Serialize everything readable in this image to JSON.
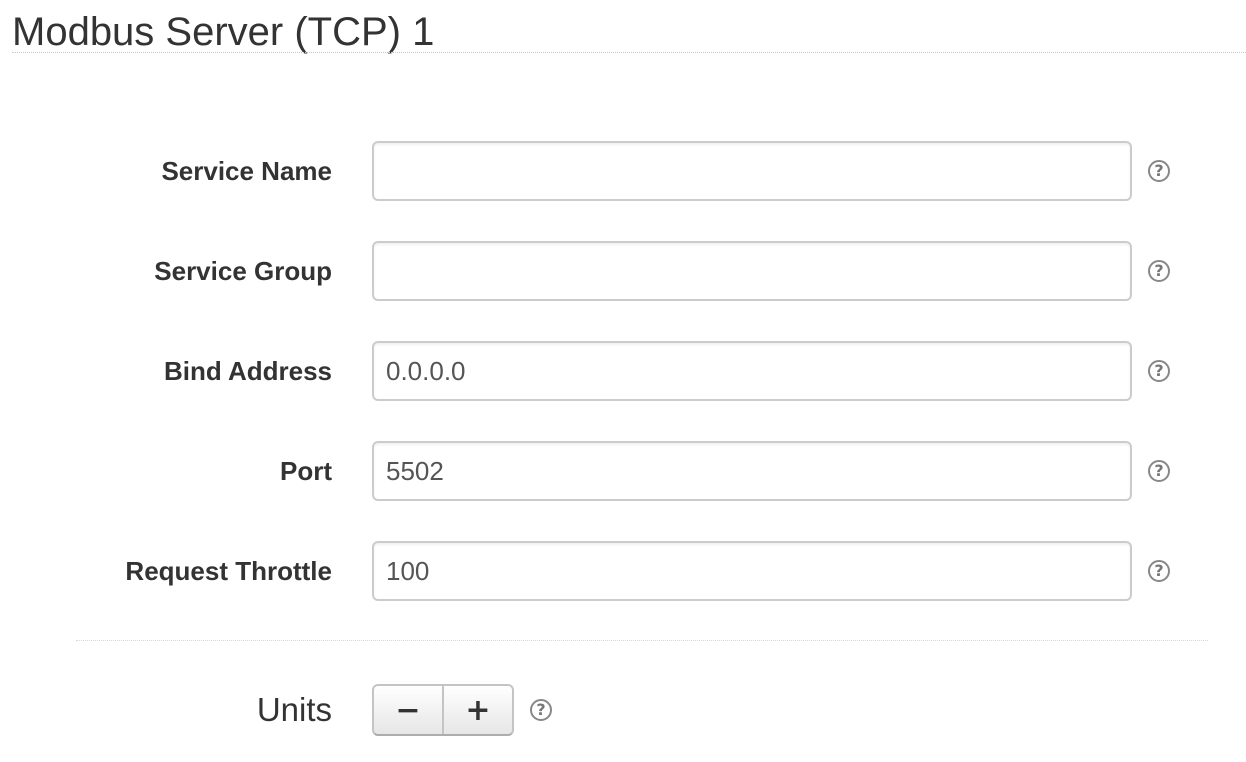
{
  "page": {
    "title": "Modbus Server (TCP) 1"
  },
  "form": {
    "fields": [
      {
        "label": "Service Name",
        "value": "",
        "help_icon": "question-circle-icon"
      },
      {
        "label": "Service Group",
        "value": "",
        "help_icon": "question-circle-icon"
      },
      {
        "label": "Bind Address",
        "value": "0.0.0.0",
        "help_icon": "question-circle-icon"
      },
      {
        "label": "Port",
        "value": "5502",
        "help_icon": "question-circle-icon"
      },
      {
        "label": "Request Throttle",
        "value": "100",
        "help_icon": "question-circle-icon"
      }
    ]
  },
  "units": {
    "label": "Units",
    "decrement_label": "−",
    "increment_label": "+",
    "help_icon": "question-circle-icon"
  },
  "icons": {
    "help_glyph": "?"
  },
  "colors": {
    "text": "#333333",
    "input_border": "#cccccc",
    "help_icon": "#888888"
  }
}
